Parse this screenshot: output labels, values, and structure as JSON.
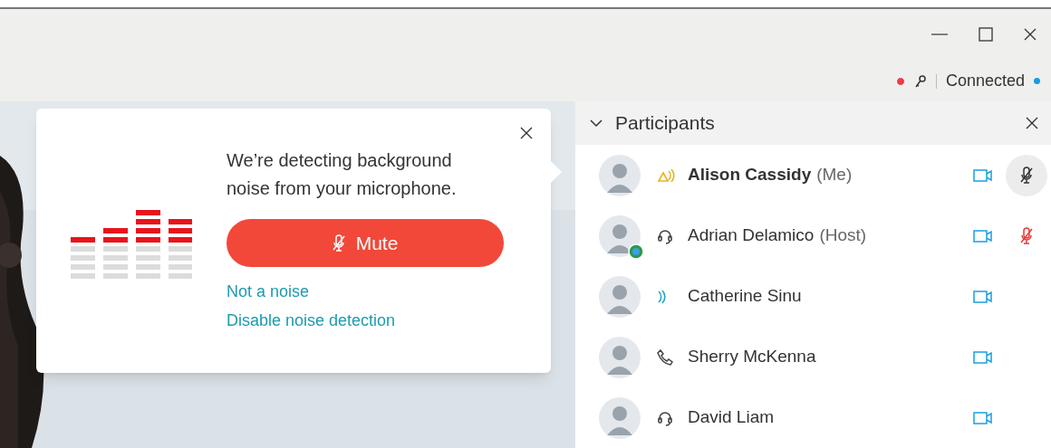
{
  "status_bar": {
    "recording": true,
    "status": "Connected"
  },
  "noise_popup": {
    "message": "We’re detecting background noise from your microphone.",
    "button": "Mute",
    "links": [
      "Not a noise",
      "Disable noise detection"
    ]
  },
  "participants": {
    "title": "Participants",
    "expanded": true,
    "items": [
      {
        "name": "Alison Cassidy",
        "role": "(Me)",
        "me": true,
        "audio": {
          "kind": "speaking_self"
        },
        "mic": {
          "kind": "self_muted"
        },
        "host_badge": false
      },
      {
        "name": "Adrian Delamico",
        "role": "(Host)",
        "me": false,
        "audio": {
          "kind": "headset"
        },
        "mic": {
          "kind": "muted"
        },
        "host_badge": true
      },
      {
        "name": "Catherine Sinu",
        "me": false,
        "audio": {
          "kind": "speaking"
        },
        "host_badge": false
      },
      {
        "name": "Sherry McKenna",
        "me": false,
        "audio": {
          "kind": "phone"
        },
        "host_badge": false
      },
      {
        "name": "David Liam",
        "me": false,
        "audio": {
          "kind": "headset"
        },
        "host_badge": false
      }
    ]
  }
}
